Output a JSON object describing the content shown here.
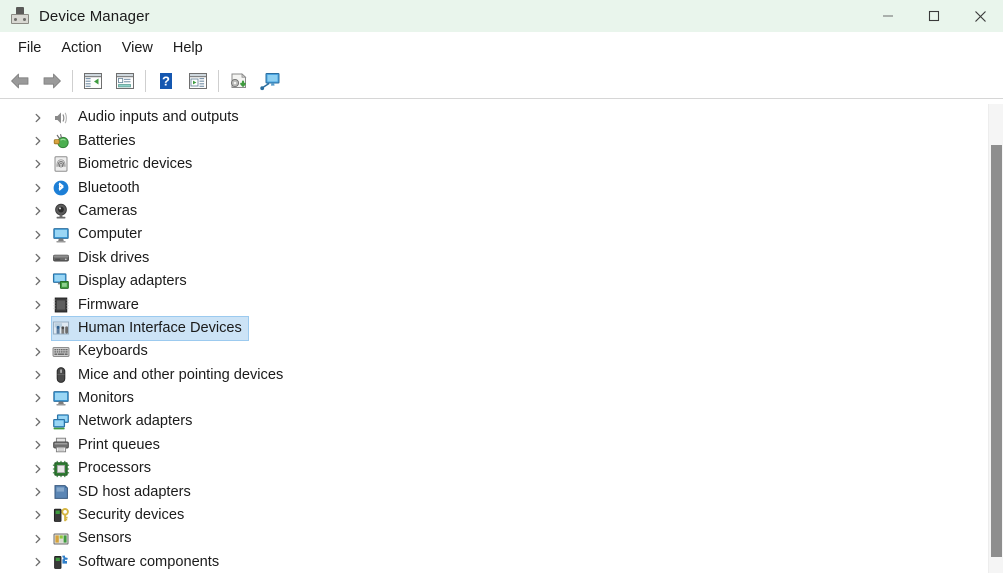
{
  "window": {
    "title": "Device Manager",
    "app_icon": "device-manager-icon",
    "titlebar_color": "#e9f5ec",
    "controls": [
      {
        "name": "minimize-button",
        "glyph": "minimize"
      },
      {
        "name": "maximize-button",
        "glyph": "maximize"
      },
      {
        "name": "close-button",
        "glyph": "close"
      }
    ]
  },
  "menubar": {
    "items": [
      {
        "label": "File"
      },
      {
        "label": "Action"
      },
      {
        "label": "View"
      },
      {
        "label": "Help"
      }
    ]
  },
  "toolbar": {
    "buttons": [
      {
        "name": "back-button",
        "icon": "back-arrow-icon",
        "tooltip": "Back"
      },
      {
        "name": "forward-button",
        "icon": "forward-arrow-icon",
        "tooltip": "Forward"
      },
      {
        "name": "show-hide-console-tree-button",
        "icon": "console-tree-icon",
        "tooltip": "Show/Hide Console Tree"
      },
      {
        "name": "properties-button",
        "icon": "properties-icon",
        "tooltip": "Properties"
      },
      {
        "name": "help-button",
        "icon": "help-question-icon",
        "tooltip": "Help"
      },
      {
        "name": "update-driver-button",
        "icon": "update-driver-icon",
        "tooltip": "Update driver"
      },
      {
        "name": "scan-hardware-changes-button",
        "icon": "scan-hardware-icon",
        "tooltip": "Scan for hardware changes"
      },
      {
        "name": "show-devices-by-connection-button",
        "icon": "device-display-icon",
        "tooltip": "Devices by connection"
      }
    ]
  },
  "tree": {
    "selected_index": 9,
    "selection_color": "#cce3f6",
    "items": [
      {
        "label": "Audio inputs and outputs",
        "icon": "speaker-icon",
        "expanded": false
      },
      {
        "label": "Batteries",
        "icon": "battery-icon",
        "expanded": false
      },
      {
        "label": "Biometric devices",
        "icon": "fingerprint-icon",
        "expanded": false
      },
      {
        "label": "Bluetooth",
        "icon": "bluetooth-icon",
        "expanded": false
      },
      {
        "label": "Cameras",
        "icon": "camera-icon",
        "expanded": false
      },
      {
        "label": "Computer",
        "icon": "computer-icon",
        "expanded": false
      },
      {
        "label": "Disk drives",
        "icon": "disk-drive-icon",
        "expanded": false
      },
      {
        "label": "Display adapters",
        "icon": "display-adapter-icon",
        "expanded": false
      },
      {
        "label": "Firmware",
        "icon": "firmware-chip-icon",
        "expanded": false
      },
      {
        "label": "Human Interface Devices",
        "icon": "human-interface-device-icon",
        "expanded": false
      },
      {
        "label": "Keyboards",
        "icon": "keyboard-icon",
        "expanded": false
      },
      {
        "label": "Mice and other pointing devices",
        "icon": "mouse-icon",
        "expanded": false
      },
      {
        "label": "Monitors",
        "icon": "monitor-icon",
        "expanded": false
      },
      {
        "label": "Network adapters",
        "icon": "network-adapter-icon",
        "expanded": false
      },
      {
        "label": "Print queues",
        "icon": "printer-icon",
        "expanded": false
      },
      {
        "label": "Processors",
        "icon": "processor-icon",
        "expanded": false
      },
      {
        "label": "SD host adapters",
        "icon": "sd-host-adapter-icon",
        "expanded": false
      },
      {
        "label": "Security devices",
        "icon": "security-device-icon",
        "expanded": false
      },
      {
        "label": "Sensors",
        "icon": "sensor-icon",
        "expanded": false
      },
      {
        "label": "Software components",
        "icon": "software-component-icon",
        "expanded": false
      }
    ]
  },
  "scrollbar": {
    "name": "vertical-scrollbar",
    "thumb_color": "#8e8e8e"
  }
}
